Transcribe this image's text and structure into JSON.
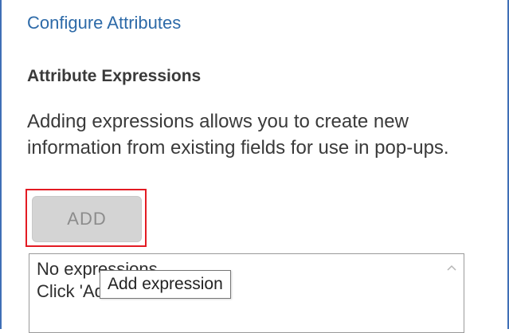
{
  "panel": {
    "title": "Configure Attributes"
  },
  "section": {
    "title": "Attribute Expressions",
    "description": "Adding expressions allows you to create new information from existing fields for use in pop-ups."
  },
  "add_button": {
    "label": "ADD",
    "state": "disabled",
    "highlight_color": "#e31b23"
  },
  "expressions_list": {
    "empty_line_1": "No expressions",
    "empty_line_2": "Click 'Add' to add one."
  },
  "tooltip": {
    "text": "Add expression"
  },
  "icons": {
    "scroll_up": "chevron-up-icon"
  },
  "colors": {
    "title": "#2d6aa8",
    "frame_border": "#3f6fb6",
    "button_bg": "#d4d4d4",
    "button_text": "#8c8c8c"
  }
}
